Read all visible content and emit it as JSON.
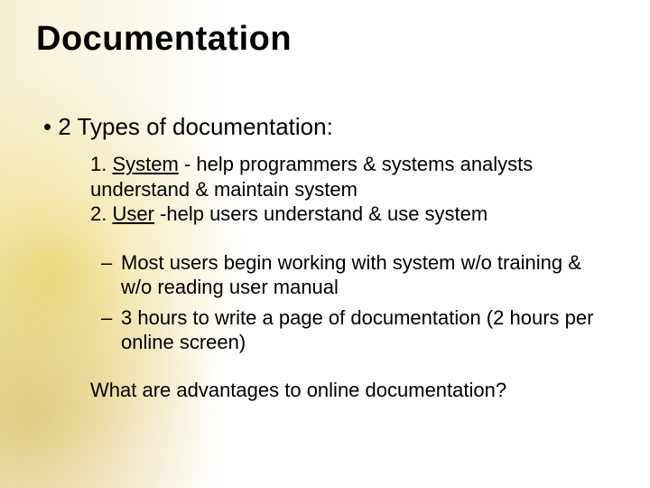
{
  "title": "Documentation",
  "heading_bullet": "2 Types of documentation:",
  "numbered_items": [
    {
      "label": "System",
      "desc": " - help programmers & systems   analysts understand & maintain system"
    },
    {
      "label": "User",
      "desc": " -help users understand & use system"
    }
  ],
  "dash_items": [
    "Most users begin working with system w/o training & w/o reading user manual",
    "3 hours to write a page of documentation (2 hours per online screen)"
  ],
  "closing_question": "What are advantages to online documentation?"
}
